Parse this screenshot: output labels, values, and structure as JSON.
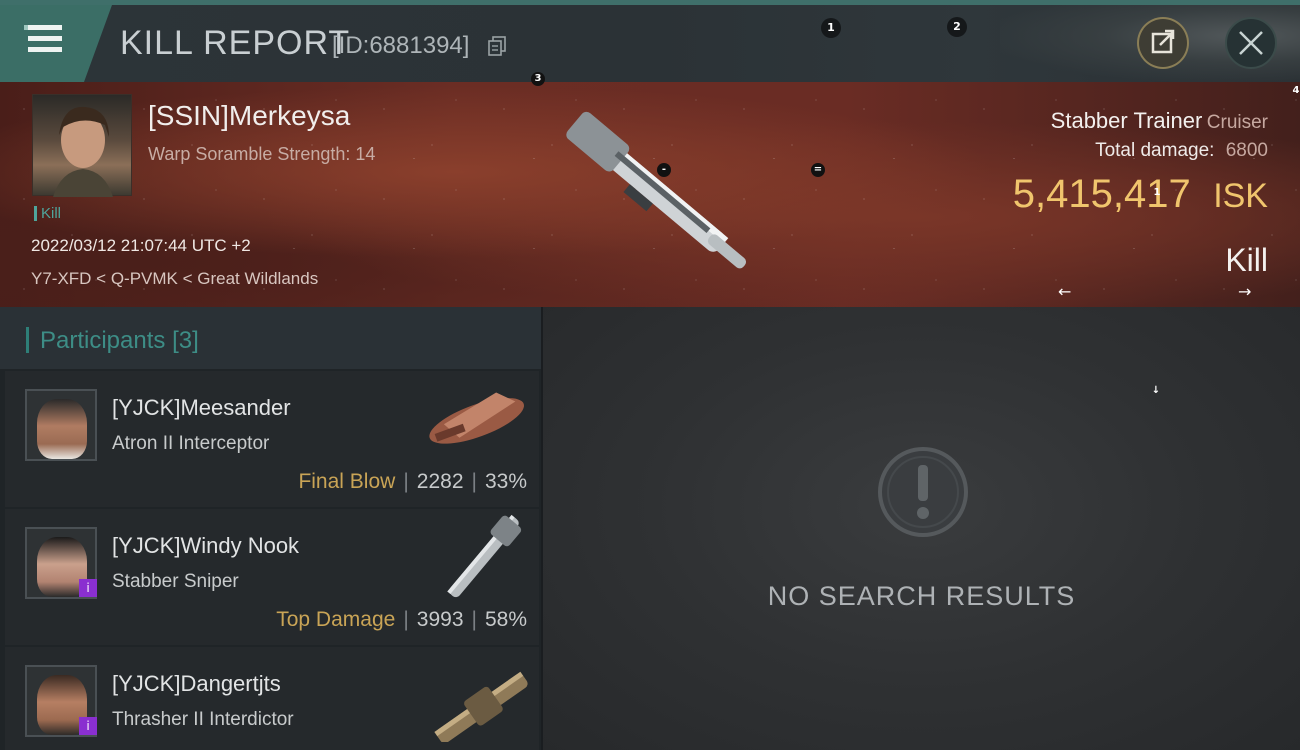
{
  "header": {
    "title": "KILL REPORT",
    "report_id": "[ID:6881394]",
    "markers": [
      "1",
      "2"
    ]
  },
  "hero": {
    "markers": [
      "3",
      "4"
    ],
    "overlay_marks": [
      "-",
      "=",
      "1",
      "←",
      "→"
    ],
    "victim": {
      "name": "[SSIN]Merkeysa",
      "warp_scramble": "Warp Soramble Strength: 14",
      "kill_tag": "Kill",
      "timestamp": "2022/03/12 21:07:44 UTC +2",
      "location": "Y7-XFD < Q-PVMK < Great Wildlands"
    },
    "ship": {
      "name": "Stabber Trainer",
      "class": "Cruiser",
      "total_damage_label": "Total damage:",
      "total_damage": "6800",
      "isk_value": "5,415,417",
      "currency": "ISK",
      "result": "Kill"
    }
  },
  "participants": {
    "title": "Participants",
    "count": "[3]",
    "rows": [
      {
        "name": "[YJCK]Meesander",
        "ship": "Atron II Interceptor",
        "tag": "Final Blow",
        "damage": "2282",
        "percent": "33%"
      },
      {
        "name": "[YJCK]Windy Nook",
        "ship": "Stabber Sniper",
        "tag": "Top Damage",
        "damage": "3993",
        "percent": "58%"
      },
      {
        "name": "[YJCK]Dangertjts",
        "ship": "Thrasher II Interdictor",
        "tag": "",
        "damage": "",
        "percent": ""
      }
    ]
  },
  "results": {
    "empty_text": "NO SEARCH RESULTS",
    "marker": "↓"
  },
  "colors": {
    "accent": "#3b6e66",
    "isk": "#f0c56d",
    "final_blow": "#c9a456",
    "badge": "#8a2fd0"
  }
}
